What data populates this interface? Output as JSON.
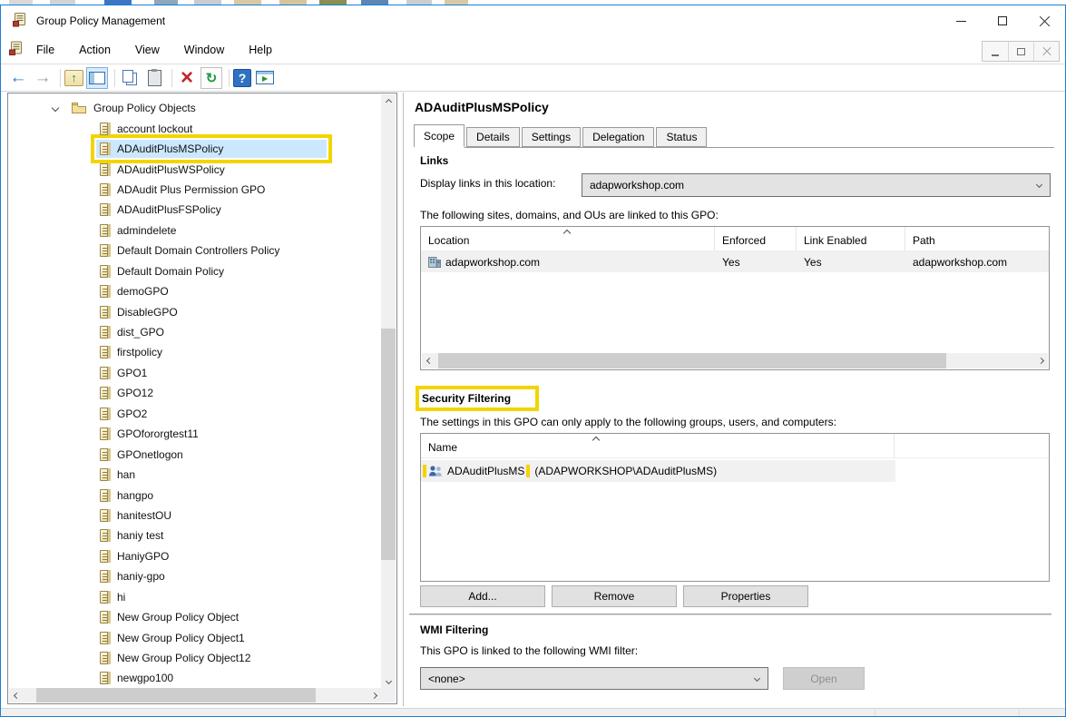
{
  "window": {
    "title": "Group Policy Management"
  },
  "menu": {
    "items": [
      "File",
      "Action",
      "View",
      "Window",
      "Help"
    ]
  },
  "toolbar": {
    "icons": [
      "back",
      "forward",
      "sep",
      "export",
      "console-tree",
      "sep",
      "copy",
      "paste",
      "sep",
      "delete",
      "refresh",
      "sep",
      "help",
      "show-window"
    ]
  },
  "tree": {
    "root_label": "Group Policy Objects",
    "items": [
      {
        "label": "account lockout"
      },
      {
        "label": "ADAuditPlusMSPolicy",
        "selected": true,
        "highlight": true
      },
      {
        "label": "ADAuditPlusWSPolicy"
      },
      {
        "label": "ADAudit Plus Permission GPO"
      },
      {
        "label": "ADAuditPlusFSPolicy"
      },
      {
        "label": "admindelete"
      },
      {
        "label": "Default Domain Controllers Policy"
      },
      {
        "label": "Default Domain Policy"
      },
      {
        "label": "demoGPO"
      },
      {
        "label": "DisableGPO"
      },
      {
        "label": "dist_GPO"
      },
      {
        "label": "firstpolicy"
      },
      {
        "label": "GPO1"
      },
      {
        "label": "GPO12"
      },
      {
        "label": "GPO2"
      },
      {
        "label": "GPOfororgtest11"
      },
      {
        "label": "GPOnetlogon"
      },
      {
        "label": "han"
      },
      {
        "label": "hangpo"
      },
      {
        "label": "hanitestOU"
      },
      {
        "label": "haniy test"
      },
      {
        "label": "HaniyGPO"
      },
      {
        "label": "haniy-gpo"
      },
      {
        "label": "hi"
      },
      {
        "label": "New Group Policy Object"
      },
      {
        "label": "New Group Policy Object1"
      },
      {
        "label": "New Group Policy Object12"
      },
      {
        "label": "newgpo100"
      }
    ]
  },
  "content": {
    "page_title": "ADAuditPlusMSPolicy",
    "tabs": [
      {
        "label": "Scope",
        "active": true
      },
      {
        "label": "Details"
      },
      {
        "label": "Settings"
      },
      {
        "label": "Delegation"
      },
      {
        "label": "Status"
      }
    ],
    "links": {
      "heading": "Links",
      "display_label": "Display links in this location:",
      "location_value": "adapworkshop.com",
      "caption": "The following sites, domains, and OUs are linked to this GPO:",
      "columns": [
        "Location",
        "Enforced",
        "Link Enabled",
        "Path"
      ],
      "row": {
        "location": "adapworkshop.com",
        "enforced": "Yes",
        "link_enabled": "Yes",
        "path": "adapworkshop.com"
      }
    },
    "security": {
      "heading": "Security Filtering",
      "caption": "The settings in this GPO can only apply to the following groups, users, and computers:",
      "name_column": "Name",
      "row": {
        "name": "ADAuditPlusMS",
        "suffix": "(ADAPWORKSHOP\\ADAuditPlusMS)"
      },
      "add_button": "Add...",
      "remove_button": "Remove",
      "properties_button": "Properties"
    },
    "wmi": {
      "heading": "WMI Filtering",
      "caption": "This GPO is linked to the following WMI filter:",
      "filter_value": "<none>",
      "open_button": "Open"
    }
  },
  "colors": {
    "window_border": "#1b7fd4",
    "selection_bg": "#cce8ff",
    "highlight_box": "#f2d500",
    "row_bg": "#f1f1f1"
  }
}
